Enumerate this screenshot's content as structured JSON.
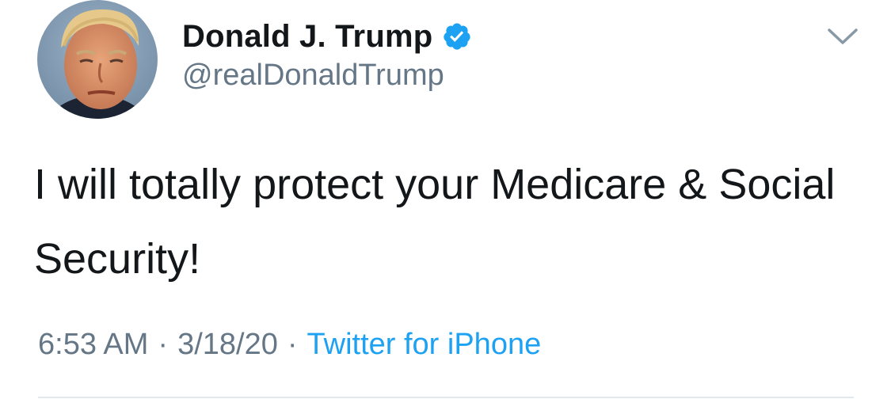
{
  "author": {
    "display_name": "Donald J. Trump",
    "handle": "@realDonaldTrump",
    "verified": true,
    "avatar_icon": "profile-photo"
  },
  "tweet": {
    "text": "I will totally protect your Medicare & Social Security!",
    "time": "6:53 AM",
    "date": "3/18/20",
    "source": "Twitter for iPhone",
    "separator": "·"
  },
  "icons": {
    "menu": "chevron-down-icon",
    "verified": "verified-badge-icon"
  },
  "colors": {
    "text": "#14171a",
    "secondary": "#657786",
    "link": "#1da1f2",
    "verified": "#1da1f2",
    "divider": "#e1e8ed"
  }
}
